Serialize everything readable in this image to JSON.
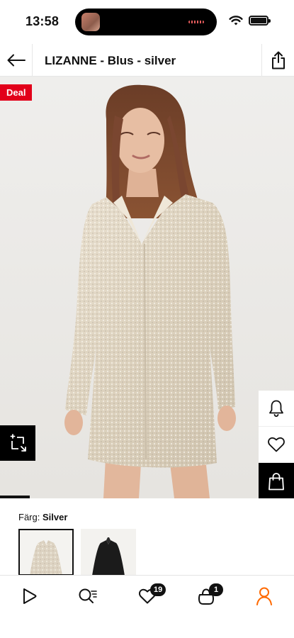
{
  "status_bar": {
    "time": "13:58"
  },
  "header": {
    "title": "LIZANNE - Blus - silver"
  },
  "product": {
    "deal_badge": "Deal",
    "image_alt": "Model wearing a silver sequin oversized shirt dress"
  },
  "colors": {
    "label": "Färg:",
    "selected": "Silver",
    "swatches": [
      {
        "name": "Silver",
        "selected": true
      },
      {
        "name": "Black",
        "selected": false
      }
    ]
  },
  "bottom_nav": {
    "items": [
      {
        "icon": "home-icon"
      },
      {
        "icon": "search-icon"
      },
      {
        "icon": "wishlist-icon",
        "badge": "19"
      },
      {
        "icon": "bag-icon",
        "badge": "1"
      },
      {
        "icon": "account-icon",
        "active": true
      }
    ]
  },
  "colors_theme": {
    "deal_red": "#e2001a",
    "accent_orange": "#ff6900",
    "text": "#111111"
  }
}
